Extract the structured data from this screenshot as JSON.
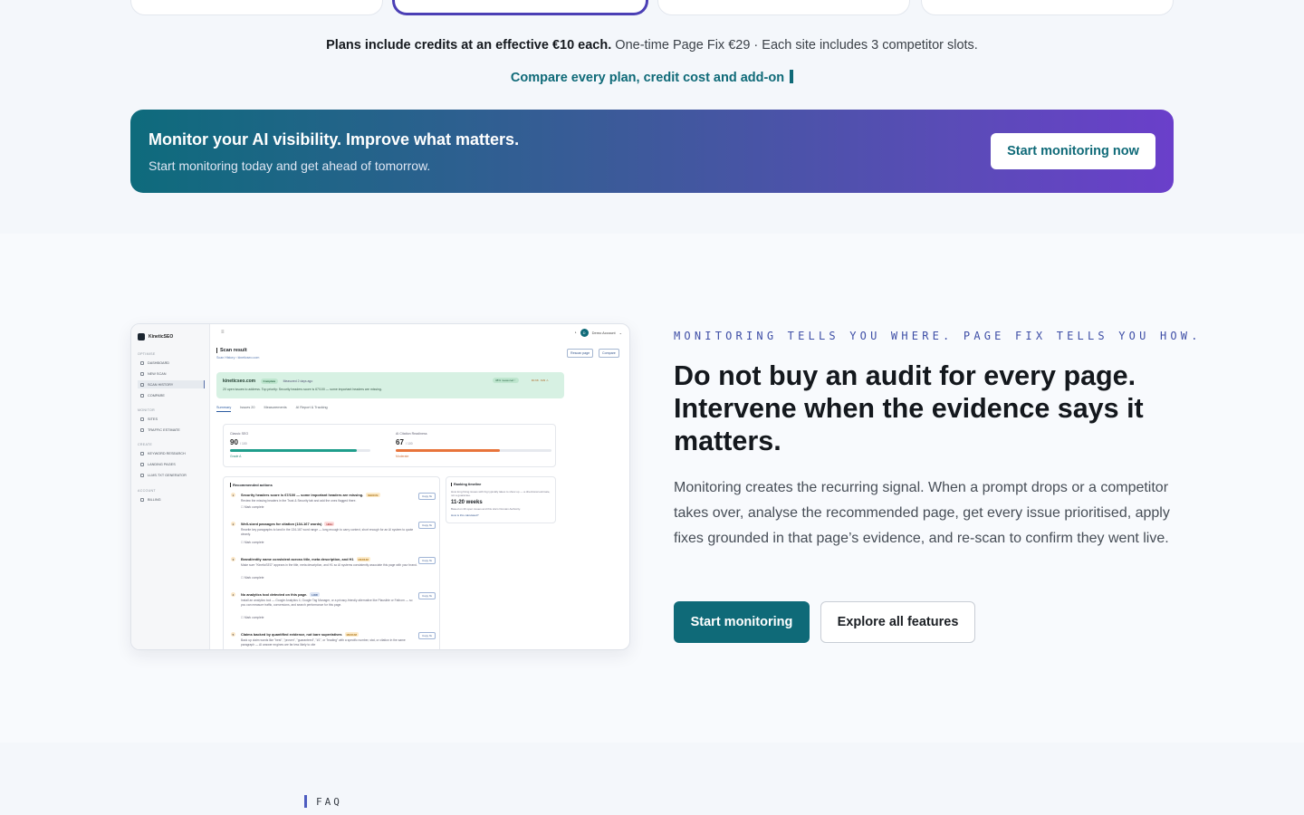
{
  "credits": {
    "bold": "Plans include credits at an effective €10 each.",
    "rest": " One-time Page Fix €29 · Each site includes 3 competitor slots."
  },
  "compare_link": "Compare every plan, credit cost and add-on",
  "cta": {
    "title": "Monitor your AI visibility. Improve what matters.",
    "subtitle": "Start monitoring today and get ahead of tomorrow.",
    "button": "Start monitoring now"
  },
  "feature": {
    "eyebrow": "MONITORING TELLS YOU WHERE. PAGE FIX TELLS YOU HOW.",
    "headline": "Do not buy an audit for every page. Intervene when the evidence says it matters.",
    "body": "Monitoring creates the recurring signal. When a prompt drops or a competitor takes over, analyse the recommended page, get every issue prioritised, apply fixes grounded in that page’s evidence, and re-scan to confirm they went live.",
    "primary_button": "Start monitoring",
    "secondary_button": "Explore all features"
  },
  "faq_label": "FAQ",
  "mockup": {
    "brand": "KineticSEO",
    "account": "Demo Account",
    "nav_groups": [
      "OPTIMISE",
      "MONITOR",
      "CREATE",
      "ACCOUNT"
    ],
    "nav": [
      "DASHBOARD",
      "NEW SCAN",
      "SCAN HISTORY",
      "COMPARE",
      "SITES",
      "TRAFFIC ESTIMATE",
      "KEYWORD RESEARCH",
      "LANDING PAGES",
      "LLMS.TXT GENERATOR",
      "BILLING"
    ],
    "page_title": "Scan result",
    "breadcrumb": "Scan History › kineticseo.com",
    "btn_rescan": "Rescan page",
    "btn_compare": "Compare",
    "banner_site": "kineticseo.com",
    "banner_status": "Complete",
    "banner_time": "Measured 2 days ago",
    "banner_desc": "20 open issues to address. Top priority: Security headers score is 67/100 — some important headers are missing.",
    "banner_pill1": "38% measured ↑",
    "banner_pill2": "€0.68 · €29 ⚠",
    "tabs": [
      "Summary",
      "Issues 20",
      "Measurements",
      "AI Report & Tracking"
    ],
    "score1_label": "Classic SEO",
    "score1_value": "90",
    "score1_unit": "/ 100",
    "score1_tag": "Grade A",
    "score1_pct": 0.9,
    "score2_label": "AI Citation Readiness",
    "score2_value": "67",
    "score2_unit": "/ 100",
    "score2_tag": "Moderate",
    "score2_pct": 0.67,
    "actions_title": "Recommended actions",
    "copy": "Copy fix",
    "mark": "Mark complete",
    "actions": [
      {
        "n": "1",
        "title": "Security headers score is 67/100 — some important headers are missing.",
        "badge": "MEDIUM",
        "desc": "Review the missing headers in the Trust & Security tab and add the ones flagged there."
      },
      {
        "n": "2",
        "title": "Well-sized passages for citation (134-167 words)",
        "badge": "HIGH",
        "desc": "Rewrite key paragraphs to land in the 134-167 word range — long enough to carry context, short enough for an AI system to quote cleanly."
      },
      {
        "n": "3",
        "title": "Brand/entity name consistent across title, meta description, and H1",
        "badge": "MEDIUM",
        "desc": "Make sure \"KineticSEO\" appears in the title, meta description, and H1 so AI systems consistently associate this page with your brand."
      },
      {
        "n": "4",
        "title": "No analytics tool detected on this page.",
        "badge": "LOW",
        "desc": "Install an analytics tool — Google Analytics 4, Google Tag Manager, or a privacy-friendly alternative like Plausible or Fathom — so you can measure traffic, conversions, and search performance for this page."
      },
      {
        "n": "5",
        "title": "Claims backed by quantified evidence, not bare superlatives",
        "badge": "MEDIUM",
        "desc": "Back up claim words like \"best\", \"proven\", \"guaranteed\", \"#1\", or \"leading\" with a specific number, stat, or citation in the same paragraph — AI answer engines are far less likely to cite"
      }
    ],
    "timeline_title": "Ranking timeline",
    "timeline_desc": "How long fixing issues with big typically takes to show up — a directional estimate, not a guarantee.",
    "timeline_value": "11-20 weeks",
    "timeline_note": "Based on 20 open issues and this site's Domain Authority.",
    "timeline_link": "How is this calculated?"
  }
}
